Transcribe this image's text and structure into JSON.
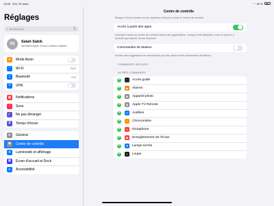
{
  "status_bar": {
    "time": "13:28",
    "date": "Ven. 29 mars",
    "battery": "69 %"
  },
  "sidebar": {
    "title": "Réglages",
    "search_placeholder": "Rechercher",
    "profile": {
      "initials": "SS",
      "name": "Salah Sabik",
      "subtitle": "Identifiant Apple, iCloud, contenu multimé..."
    },
    "connectivity": [
      {
        "label": "Mode Avion",
        "icon": "airplane-icon",
        "color": "#ff9500",
        "type": "toggle",
        "on": false
      },
      {
        "label": "Wi-Fi",
        "icon": "wifi-icon",
        "color": "#007aff",
        "type": "value",
        "value": "Non"
      },
      {
        "label": "Bluetooth",
        "icon": "bluetooth-icon",
        "color": "#007aff",
        "type": "value",
        "value": "Oui"
      },
      {
        "label": "VPN",
        "icon": "vpn-icon",
        "color": "#007aff",
        "type": "toggle",
        "on": false
      }
    ],
    "notifications": [
      {
        "label": "Notifications",
        "icon": "notifications-icon",
        "color": "#ff3b30"
      },
      {
        "label": "Sons",
        "icon": "sounds-icon",
        "color": "#ff2d55"
      },
      {
        "label": "Ne pas déranger",
        "icon": "moon-icon",
        "color": "#5856d6"
      },
      {
        "label": "Temps d'écran",
        "icon": "hourglass-icon",
        "color": "#5856d6"
      }
    ],
    "general": [
      {
        "label": "Général",
        "icon": "gear-icon",
        "color": "#8e8e93",
        "active": false
      },
      {
        "label": "Centre de contrôle",
        "icon": "control-center-icon",
        "color": "#8e8e93",
        "active": true
      },
      {
        "label": "Luminosité et affichage",
        "icon": "brightness-icon",
        "color": "#007aff",
        "active": false
      },
      {
        "label": "Écran d'accueil et Dock",
        "icon": "home-screen-icon",
        "color": "#3a3aff",
        "active": false
      },
      {
        "label": "Accessibilité",
        "icon": "accessibility-icon",
        "color": "#007aff",
        "active": false
      }
    ]
  },
  "main": {
    "header": "Centre de contrôle",
    "intro": "Balayez l'écran à partir du coin supérieur droit pour ouvrir le Centre de contrôle.",
    "apps_access": {
      "label": "Accès à partir des apps",
      "on": true
    },
    "apps_desc": "Autorisez l'accès au centre de contrôle depuis des applications. Lorsque c'est désactivé, vous ne pouvez y accéder que depuis l'écran d'accueil.",
    "home_controls": {
      "label": "Commandes de Maison",
      "on": false
    },
    "home_desc": "Incluez des suggestions de commandes pour les pièces et les accessoires de Maison.",
    "included_title": "COMMANDES INCLUSES",
    "more_title": "AUTRES COMMANDES",
    "commands": [
      {
        "label": "Accès guidé",
        "icon": "guided-access-icon",
        "color": "#1c1c1e"
      },
      {
        "label": "Alarme",
        "icon": "alarm-icon",
        "color": "#ff9500"
      },
      {
        "label": "Appareil photo",
        "icon": "camera-icon",
        "color": "#8e8e93"
      },
      {
        "label": "Apple TV Remote",
        "icon": "apple-tv-remote-icon",
        "color": "#8e8e93"
      },
      {
        "label": "Audition",
        "icon": "hearing-icon",
        "color": "#007aff"
      },
      {
        "label": "Chronomètre",
        "icon": "stopwatch-icon",
        "color": "#ff9500"
      },
      {
        "label": "Dictaphone",
        "icon": "voice-memos-icon",
        "color": "#ff3b30"
      },
      {
        "label": "Enregistrement de l'écran",
        "icon": "screen-recording-icon",
        "color": "#ff3b30"
      },
      {
        "label": "Lampe torche",
        "icon": "flashlight-icon",
        "color": "#007aff"
      },
      {
        "label": "Loupe",
        "icon": "magnifier-icon",
        "color": "#1c1c1e"
      }
    ]
  }
}
